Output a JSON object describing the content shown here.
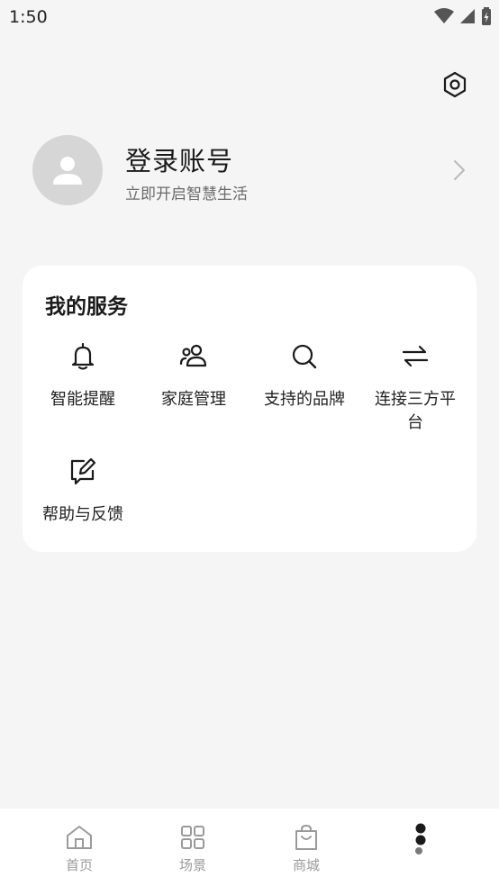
{
  "status_bar": {
    "time": "1:50"
  },
  "profile": {
    "name": "登录账号",
    "subtitle": "立即开启智慧生活"
  },
  "services": {
    "title": "我的服务",
    "items": [
      {
        "label": "智能提醒",
        "icon": "bell-icon"
      },
      {
        "label": "家庭管理",
        "icon": "family-icon"
      },
      {
        "label": "支持的品牌",
        "icon": "search-icon"
      },
      {
        "label": "连接三方平台",
        "icon": "swap-arrows-icon"
      },
      {
        "label": "帮助与反馈",
        "icon": "feedback-edit-icon"
      }
    ]
  },
  "bottom_nav": {
    "items": [
      {
        "label": "首页",
        "icon": "home-icon"
      },
      {
        "label": "场景",
        "icon": "grid-icon"
      },
      {
        "label": "商城",
        "icon": "shopping-bag-icon"
      },
      {
        "label": "",
        "icon": "profile-dots-icon",
        "active": true
      }
    ]
  },
  "colors": {
    "background": "#f5f5f5",
    "card": "#ffffff",
    "text_primary": "#1a1a1a",
    "text_secondary": "#6b6b6b",
    "nav_inactive": "#9a9a9a",
    "avatar_bg": "#d6d6d6"
  }
}
